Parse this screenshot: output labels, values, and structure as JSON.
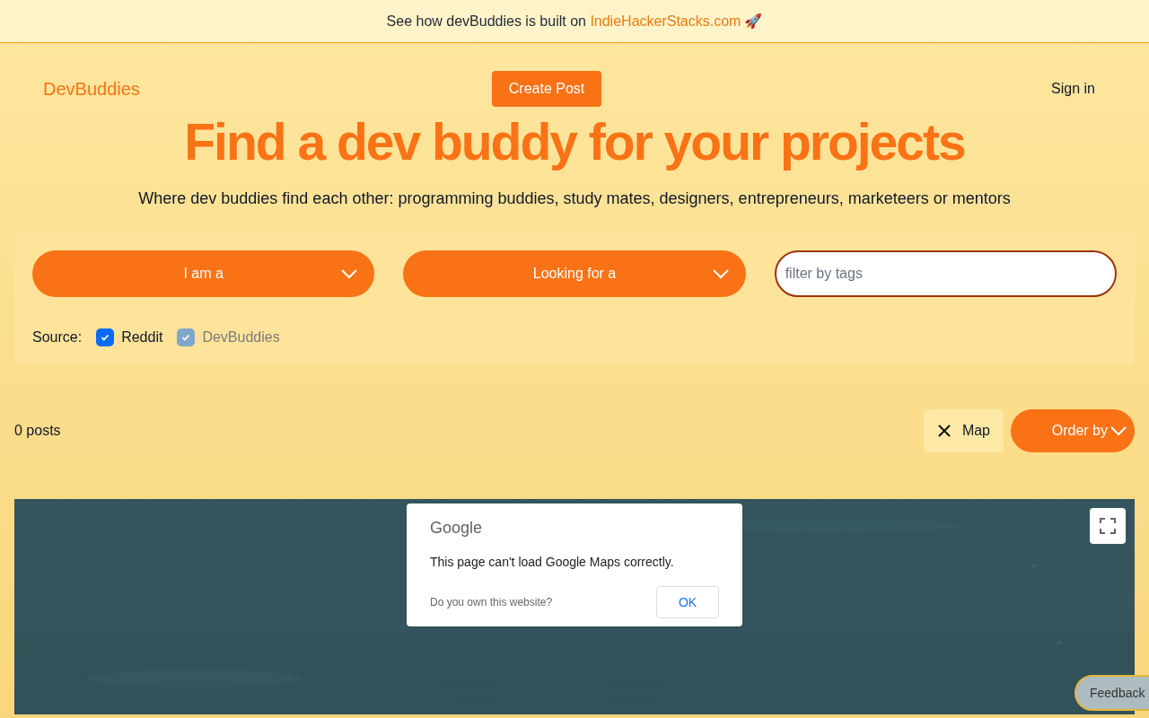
{
  "banner": {
    "text": "See how devBuddies is built on",
    "link": "IndieHackerStacks.com",
    "emoji": "🚀"
  },
  "header": {
    "logo": "DevBuddies",
    "create_button": "Create Post",
    "sign_in": "Sign in"
  },
  "hero": {
    "title": "Find a dev buddy for your projects",
    "subtitle": "Where dev buddies find each other: programming buddies, study mates, designers, entrepreneurs, marketeers or mentors"
  },
  "filters": {
    "selects": [
      {
        "label": "I am a"
      },
      {
        "label": "Looking for a"
      }
    ],
    "tags": {
      "placeholder": "filter by tags"
    },
    "source_label": "Source:",
    "sources": [
      {
        "label": "Reddit",
        "checked": true,
        "disabled": false
      },
      {
        "label": "DevBuddies",
        "checked": true,
        "disabled": true
      }
    ]
  },
  "results": {
    "count": "0 posts",
    "map_button": "Map",
    "order_button": "Order by"
  },
  "map": {
    "kind": "picture",
    "dialog": {
      "brand": "Google",
      "message": "This page can't load Google Maps correctly.",
      "question": "Do you own this website?",
      "ok": "OK"
    }
  },
  "feedback": "Feedback"
}
